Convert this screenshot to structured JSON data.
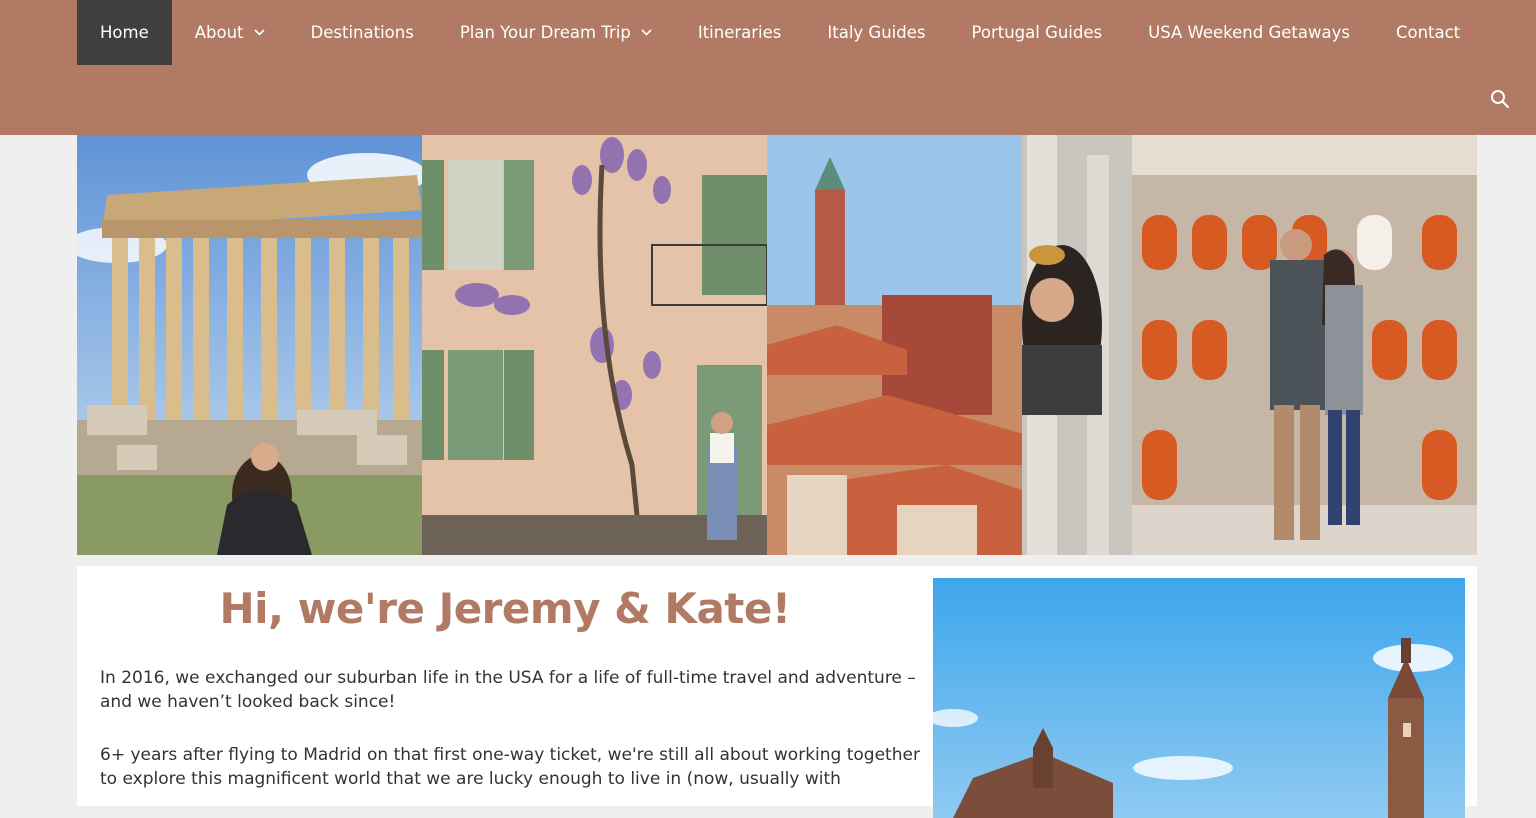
{
  "nav": {
    "items": [
      {
        "label": "Home",
        "active": true
      },
      {
        "label": "About",
        "dropdown": true
      },
      {
        "label": "Destinations"
      },
      {
        "label": "Plan Your Dream Trip",
        "dropdown": true
      },
      {
        "label": "Itineraries"
      },
      {
        "label": "Italy Guides"
      },
      {
        "label": "Portugal Guides"
      },
      {
        "label": "USA Weekend Getaways"
      },
      {
        "label": "Contact"
      }
    ],
    "search_icon": "search-icon"
  },
  "hero": {
    "panels": [
      "parthenon-photo",
      "wisteria-house-photo",
      "venice-rooftops-photo",
      "colosseum-couple-photo"
    ]
  },
  "intro": {
    "heading": "Hi, we're Jeremy & Kate!",
    "paragraph1": "In 2016, we exchanged our suburban life in the USA for a life of full-time travel and adventure – and we haven’t looked back since!",
    "paragraph2": "6+ years after flying to Madrid on that first one-way ticket, we're still all about working together to explore this magnificent world that we are lucky enough to live in (now, usually with"
  },
  "colors": {
    "brand": "#b07a64",
    "nav_active": "#3f3f3f",
    "page_bg": "#efefef"
  }
}
